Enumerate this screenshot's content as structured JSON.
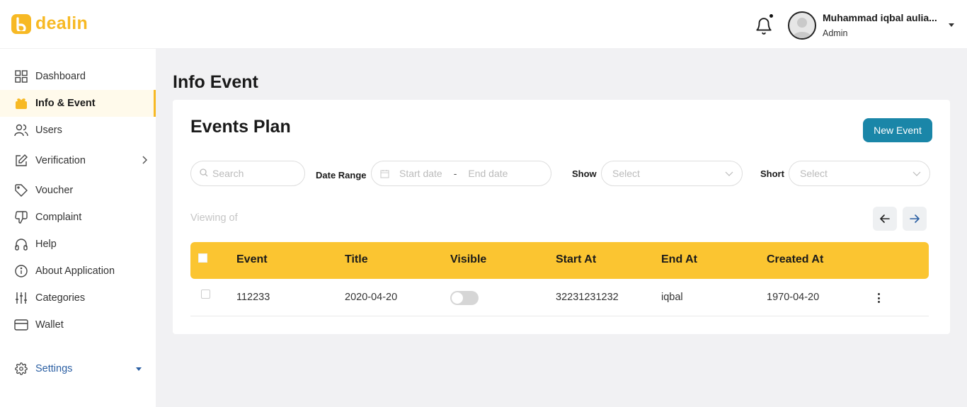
{
  "app": {
    "name": "dealin",
    "brand_color": "#f7b924",
    "accent_color": "#1a86a8",
    "table_header_color": "#fbc531"
  },
  "header": {
    "notification_icon": "bell-icon",
    "user": {
      "name": "Muhammad iqbal aulia...",
      "role": "Admin"
    }
  },
  "sidebar": {
    "items": [
      {
        "label": "Dashboard",
        "icon": "grid-icon"
      },
      {
        "label": "Info & Event",
        "icon": "gift-icon",
        "active": true
      },
      {
        "label": "Users",
        "icon": "users-icon"
      },
      {
        "label": "Verification",
        "icon": "edit-icon"
      },
      {
        "label": "Voucher",
        "icon": "tag-icon"
      },
      {
        "label": "Complaint",
        "icon": "thumbs-down-icon"
      },
      {
        "label": "Help",
        "icon": "headphones-icon"
      },
      {
        "label": "About Application",
        "icon": "info-icon"
      },
      {
        "label": "Categories",
        "icon": "sliders-icon"
      },
      {
        "label": "Wallet",
        "icon": "wallet-icon"
      }
    ],
    "settings": {
      "label": "Settings",
      "icon": "gear-icon"
    }
  },
  "main": {
    "page_title": "Info Event",
    "card_title": "Events Plan",
    "new_button": "New Event",
    "filters": {
      "search_placeholder": "Search",
      "date_range_label": "Date Range",
      "start_placeholder": "Start date",
      "separator": "-",
      "end_placeholder": "End date",
      "show_label": "Show",
      "show_placeholder": "Select",
      "short_label": "Short",
      "short_placeholder": "Select"
    },
    "viewing_text": "Viewing of",
    "table": {
      "columns": [
        "Event",
        "Title",
        "Visible",
        "Start At",
        "End At",
        "Created At"
      ],
      "rows": [
        {
          "event": "112233",
          "title": "2020-04-20",
          "visible": false,
          "start_at": "32231231232",
          "end_at": "iqbal",
          "created_at": "1970-04-20"
        }
      ]
    }
  }
}
